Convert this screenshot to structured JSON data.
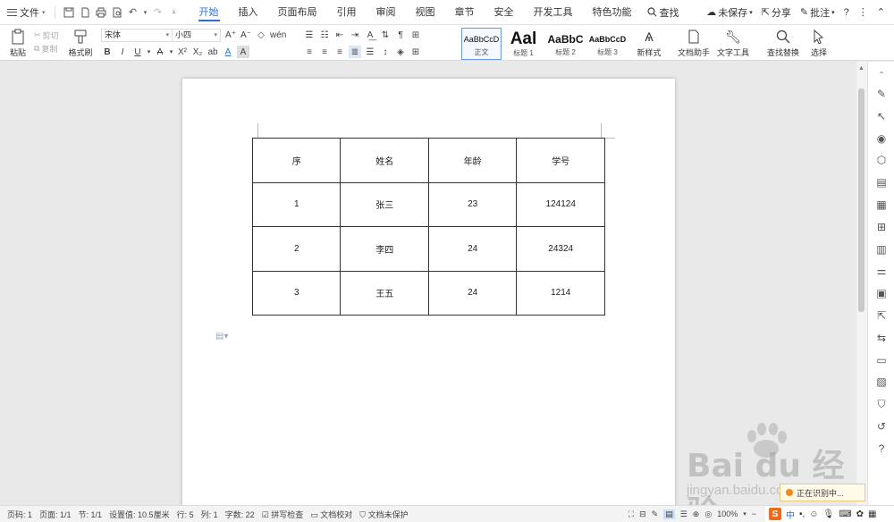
{
  "menubar": {
    "file_label": "文件",
    "tabs": [
      "开始",
      "插入",
      "页面布局",
      "引用",
      "审阅",
      "视图",
      "章节",
      "安全",
      "开发工具",
      "特色功能"
    ],
    "active_tab": "开始",
    "search_label": "查找",
    "right": {
      "unsaved": "未保存",
      "share": "分享",
      "comment": "批注",
      "help": "?"
    }
  },
  "ribbon": {
    "paste": "粘贴",
    "cut": "剪切",
    "copy": "复制",
    "format_painter": "格式刷",
    "font_name": "宋体",
    "font_size": "小四",
    "styles": [
      {
        "preview": "AaBbCcD",
        "name": "正文"
      },
      {
        "preview": "Aal",
        "name": "标题 1"
      },
      {
        "preview": "AaBbC",
        "name": "标题 2"
      },
      {
        "preview": "AaBbCcD",
        "name": "标题 3"
      }
    ],
    "new_style": "新样式",
    "doc_assistant": "文档助手",
    "text_tools": "文字工具",
    "find_replace": "查找替换",
    "select": "选择"
  },
  "table": {
    "header": [
      "序",
      "姓名",
      "年龄",
      "学号"
    ],
    "rows": [
      [
        "1",
        "张三",
        "23",
        "124124"
      ],
      [
        "2",
        "李四",
        "24",
        "24324"
      ],
      [
        "3",
        "王五",
        "24",
        "1214"
      ]
    ]
  },
  "statusbar": {
    "page_num": "页码: 1",
    "pages": "页面: 1/1",
    "section": "节: 1/1",
    "setting": "设置值: 10.5厘米",
    "row": "行: 5",
    "col": "列: 1",
    "words": "字数: 22",
    "spell": "拼写检查",
    "proof": "文档校对",
    "protect": "文档未保护",
    "zoom": "100%"
  },
  "ime": {
    "mode": "中",
    "toast": "正在识别中..."
  },
  "watermark": {
    "brand": "Bai du 经验",
    "url": "jingyan.baidu.com"
  }
}
